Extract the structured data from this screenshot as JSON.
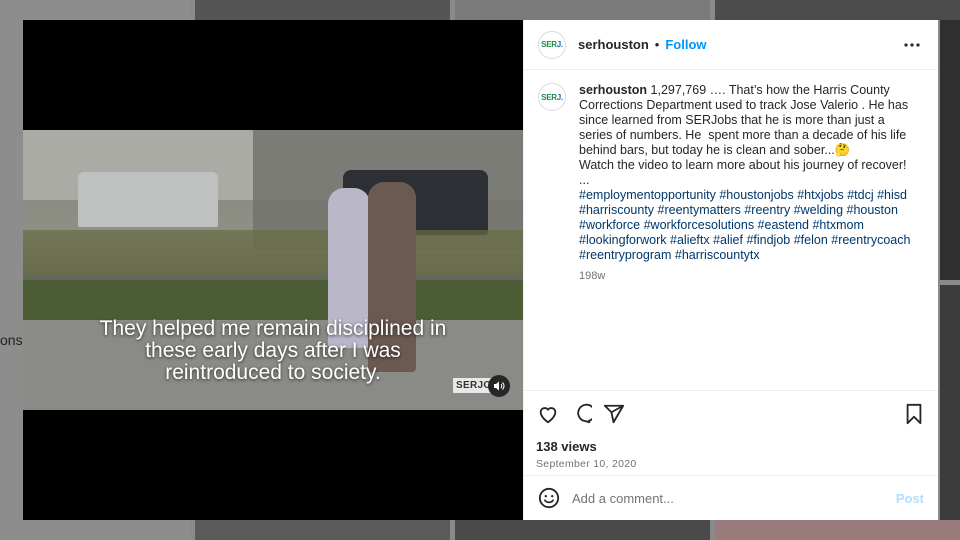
{
  "background": {
    "fragment_text": "ons"
  },
  "video": {
    "caption_lines": [
      "They helped me remain disciplined in",
      "these early days after I was",
      "reintroduced to society."
    ],
    "watermark": "SERJO",
    "mute_icon": "speaker-icon"
  },
  "header": {
    "avatar_text_a": "SER",
    "avatar_text_b": "J.",
    "username": "serhouston",
    "separator": "•",
    "follow_label": "Follow",
    "more_icon": "more-options-icon"
  },
  "post": {
    "username": "serhouston",
    "caption": " 1,297,769 …. That’s how the Harris County Corrections Department used to track Jose Valerio . He has since learned from SERJobs that he is more than just a series of numbers. He  spent more than a decade of his life behind bars, but today he is clean and sober...🤔\nWatch the video to learn more about his journey of recover!\n...\n",
    "hashtags": "#employmentopportunity #houstonjobs #htxjobs #tdcj #hisd #harriscounty #reentymatters #reentry #welding #houston #workforce #workforcesolutions #eastend #htxmom #lookingforwork #alieftx #alief #findjob #felon #reentrycoach #reentryprogram #harriscountytx",
    "age": "198w"
  },
  "actions": {
    "icons": [
      "heart-icon",
      "comment-icon",
      "share-icon",
      "bookmark-icon"
    ],
    "views": "138 views",
    "date": "September 10, 2020"
  },
  "comment": {
    "placeholder": "Add a comment...",
    "post_label": "Post"
  }
}
